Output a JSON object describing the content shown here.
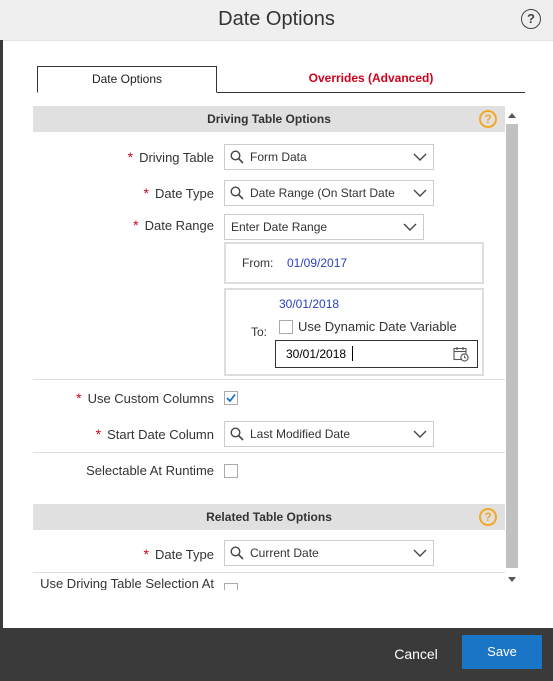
{
  "dialog": {
    "title": "Date Options",
    "help_icon": "question-circle-icon"
  },
  "tabs": [
    {
      "label": "Date Options",
      "active": true
    },
    {
      "label": "Overrides (Advanced)",
      "active": false
    }
  ],
  "driving_section": {
    "title": "Driving Table Options",
    "help_icon": "question-circle-icon",
    "driving_table": {
      "label": "Driving Table",
      "required_mark": "*",
      "value": "Form Data"
    },
    "date_type": {
      "label": "Date Type",
      "required_mark": "*",
      "value": "Date Range (On Start Date"
    },
    "date_range": {
      "label": "Date Range",
      "required_mark": "*",
      "value": "Enter Date Range"
    },
    "from": {
      "label": "From:",
      "value": "01/09/2017"
    },
    "to": {
      "label": "To:",
      "display_value": "30/01/2018",
      "dynamic_checkbox_label": "Use Dynamic Date Variable",
      "input_value": "30/01/2018"
    },
    "use_custom_columns": {
      "label": "Use Custom Columns",
      "required_mark": "*",
      "checked": true
    },
    "start_date_column": {
      "label": "Start Date Column",
      "required_mark": "*",
      "value": "Last Modified Date"
    },
    "selectable_at_runtime": {
      "label": "Selectable At Runtime",
      "checked": false
    }
  },
  "related_section": {
    "title": "Related Table Options",
    "help_icon": "question-circle-icon",
    "date_type": {
      "label": "Date Type",
      "required_mark": "*",
      "value": "Current Date"
    },
    "use_driving_selection": {
      "label": "Use Driving Table Selection At",
      "checked": false
    }
  },
  "footer": {
    "cancel_label": "Cancel",
    "save_label": "Save"
  },
  "colors": {
    "accent_blue": "#1a75c7",
    "required_red": "#d0021b",
    "help_orange": "#f5a623",
    "date_text_blue": "#2a3fbf"
  }
}
